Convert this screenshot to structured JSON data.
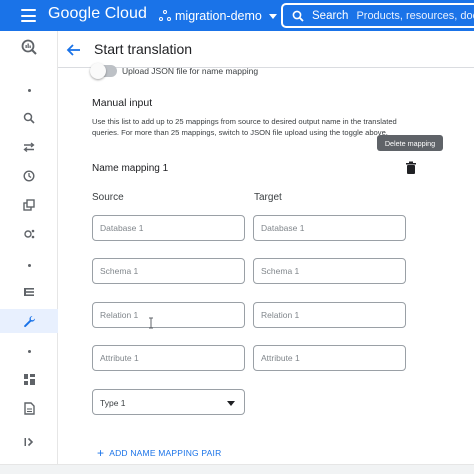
{
  "topbar": {
    "logo": "Google Cloud",
    "project": "migration-demo",
    "search_label": "Search",
    "search_placeholder": "Products, resources, docs"
  },
  "rail": {
    "icons": [
      "bigquery-icon",
      "search-icon",
      "transfer-icon",
      "history-icon",
      "workflow-icon",
      "analytics-icon",
      "list-icon",
      "wrench-icon",
      "dashboard-icon",
      "document-icon",
      "expand-icon"
    ],
    "active": "wrench-icon"
  },
  "header": {
    "title": "Start translation"
  },
  "upload_toggle": {
    "label": "Upload JSON file for name mapping",
    "enabled": false
  },
  "manual_input": {
    "title": "Manual input",
    "helper": "Use this list to add up to 25 mappings from source to desired output name in the translated queries. For more than 25 mappings, switch to JSON file upload using the toggle above."
  },
  "mapping": {
    "title": "Name mapping 1",
    "delete_tooltip": "Delete mapping",
    "source_label": "Source",
    "target_label": "Target",
    "source_fields": [
      {
        "placeholder": "Database 1",
        "value": ""
      },
      {
        "placeholder": "Schema 1",
        "value": ""
      },
      {
        "placeholder": "Relation 1",
        "value": ""
      },
      {
        "placeholder": "Attribute 1",
        "value": ""
      }
    ],
    "target_fields": [
      {
        "placeholder": "Database 1",
        "value": ""
      },
      {
        "placeholder": "Schema 1",
        "value": ""
      },
      {
        "placeholder": "Relation 1",
        "value": ""
      },
      {
        "placeholder": "Attribute 1",
        "value": ""
      }
    ],
    "type_select": {
      "value": "Type 1"
    }
  },
  "add_button": {
    "plus": "+",
    "label": "ADD NAME MAPPING PAIR"
  },
  "colors": {
    "brand_blue": "#1a73e8",
    "border": "#9aa0a6",
    "tooltip_bg": "#5f6368"
  }
}
